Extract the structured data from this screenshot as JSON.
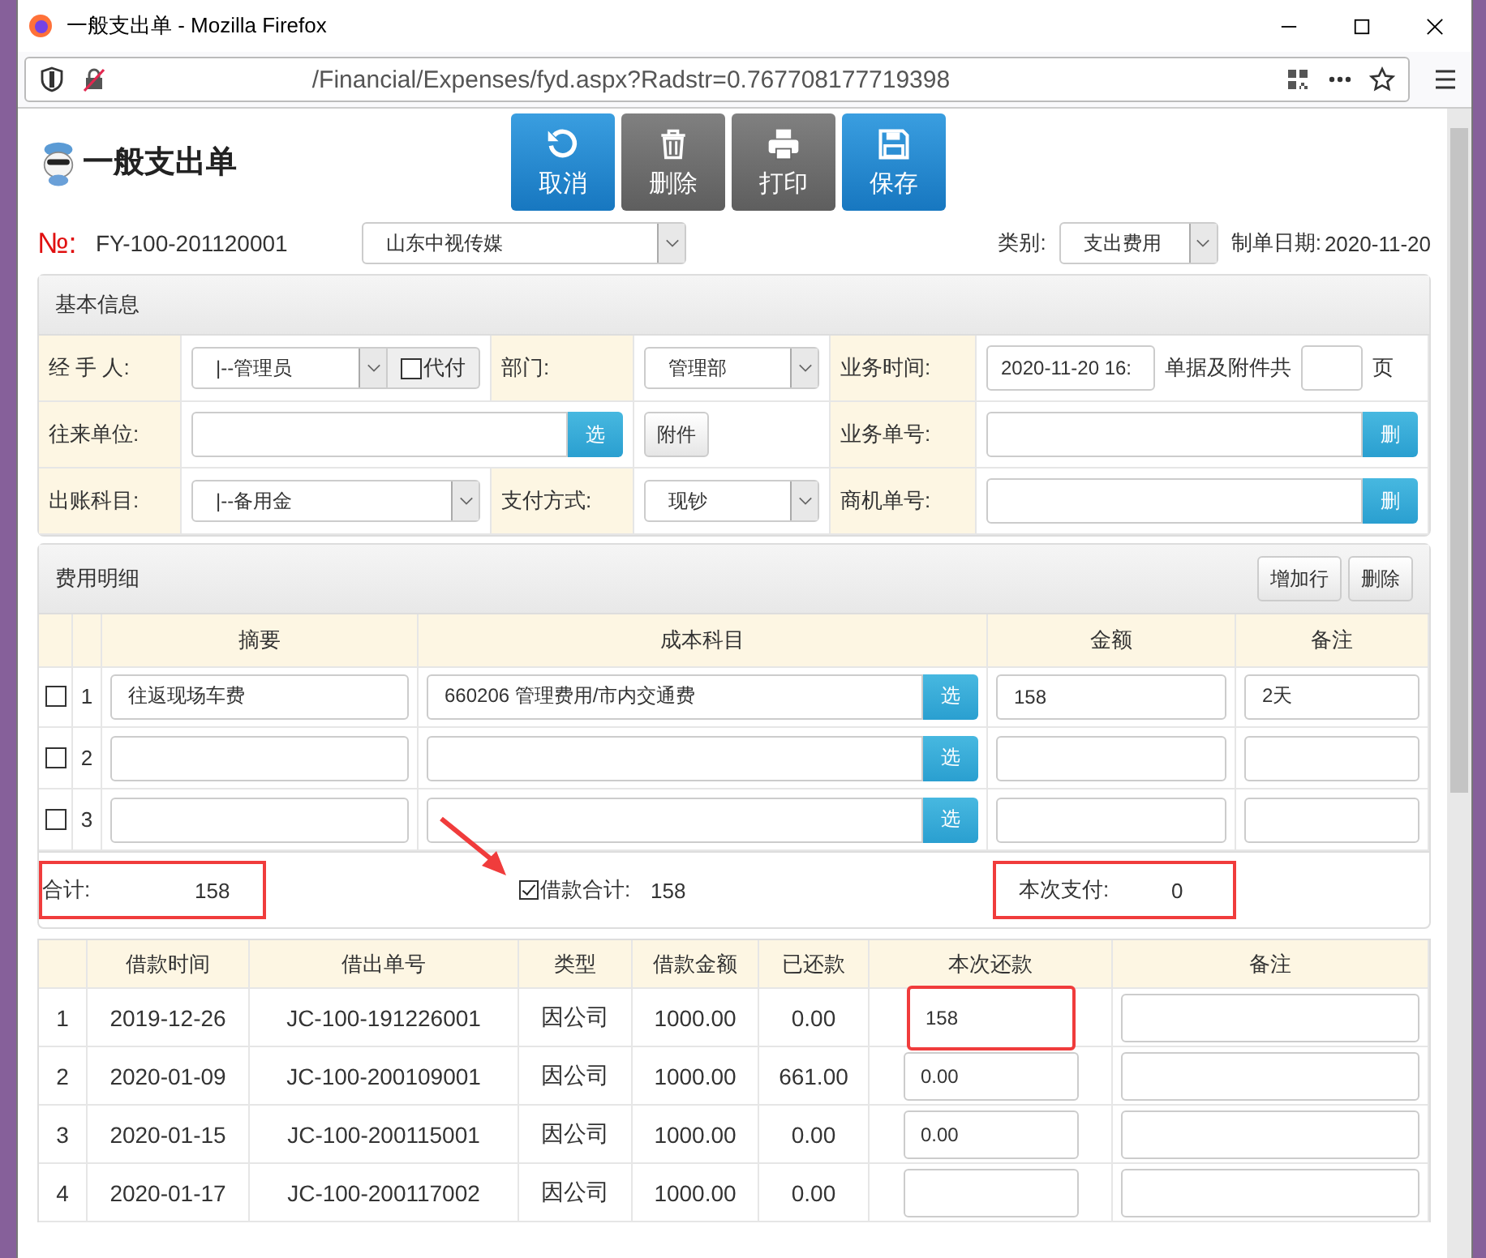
{
  "window": {
    "title": "一般支出单 - Mozilla Firefox",
    "url": "/Financial/Expenses/fyd.aspx?Radstr=0.767708177719398"
  },
  "toolbar": [
    {
      "label": "取消",
      "kind": "cancel"
    },
    {
      "label": "删除",
      "kind": "delete"
    },
    {
      "label": "打印",
      "kind": "print"
    },
    {
      "label": "保存",
      "kind": "save"
    }
  ],
  "page_title": "一般支出单",
  "header": {
    "no_label": "№:",
    "no": "FY-100-201120001",
    "company": "山东中视传媒",
    "category_label": "类别:",
    "category": "支出费用",
    "date_label": "制单日期:",
    "date": "2020-11-20"
  },
  "basic_info": {
    "title": "基本信息",
    "rows": [
      [
        {
          "kind": "label",
          "text": "经 手 人:"
        },
        {
          "kind": "select_check",
          "value": "|--管理员",
          "check_label": "代付",
          "checked": false
        },
        {
          "kind": "label",
          "text": "部门:"
        },
        {
          "kind": "select",
          "value": "管理部"
        },
        {
          "kind": "label",
          "text": "业务时间:"
        },
        {
          "kind": "time_pages",
          "value": "2020-11-20 16:",
          "pages_label": "单据及附件共",
          "unit": "页"
        }
      ],
      [
        {
          "kind": "label",
          "text": "往来单位:"
        },
        {
          "kind": "input_button",
          "button": "选"
        },
        "",
        {
          "kind": "button",
          "text": "附件"
        },
        {
          "kind": "label",
          "text": "业务单号:"
        },
        {
          "kind": "input_button",
          "button": "删"
        }
      ],
      [
        {
          "kind": "label",
          "text": "出账科目:"
        },
        {
          "kind": "select",
          "value": "|--备用金"
        },
        {
          "kind": "label",
          "text": "支付方式:"
        },
        {
          "kind": "select",
          "value": "现钞"
        },
        {
          "kind": "label",
          "text": "商机单号:"
        },
        {
          "kind": "input_button",
          "button": "删"
        }
      ]
    ]
  },
  "expense_detail": {
    "title": "费用明细",
    "buttons": [
      "增加行",
      "删除"
    ],
    "columns": [
      "摘要",
      "成本科目",
      "金额",
      "备注"
    ],
    "rows": [
      {
        "no": "1",
        "checked": false,
        "summary": "往返现场车费",
        "subject": "660206 管理费用/市内交通费",
        "pick": "选",
        "amount": "158",
        "note": "2天"
      },
      {
        "no": "2",
        "checked": false,
        "pick": "选"
      },
      {
        "no": "3",
        "checked": false,
        "pick": "选"
      }
    ]
  },
  "totals": {
    "total_label": "合计:",
    "total": "158",
    "total_highlighted": true,
    "loan_checked": true,
    "loan_label": "借款合计:",
    "loan_total": "158",
    "pay_label": "本次支付:",
    "pay": "0",
    "pay_highlighted": true
  },
  "loans": {
    "columns": [
      "借款时间",
      "借出单号",
      "类型",
      "借款金额",
      "已还款",
      "本次还款",
      "备注"
    ],
    "rows": [
      {
        "no": "1",
        "date": "2019-12-26",
        "number": "JC-100-191226001",
        "type": "因公司",
        "amount": "1000.00",
        "repaid": "0.00",
        "repay": "158",
        "highlighted": true
      },
      {
        "no": "2",
        "date": "2020-01-09",
        "number": "JC-100-200109001",
        "type": "因公司",
        "amount": "1000.00",
        "repaid": "661.00",
        "repay": "0.00",
        "highlighted": false
      },
      {
        "no": "3",
        "date": "2020-01-15",
        "number": "JC-100-200115001",
        "type": "因公司",
        "amount": "1000.00",
        "repaid": "0.00",
        "repay": "0.00",
        "highlighted": false
      },
      {
        "no": "4",
        "date": "2020-01-17",
        "number": "JC-100-200117002",
        "type": "因公司",
        "amount": "1000.00",
        "repaid": "0.00",
        "highlighted": false
      }
    ]
  }
}
